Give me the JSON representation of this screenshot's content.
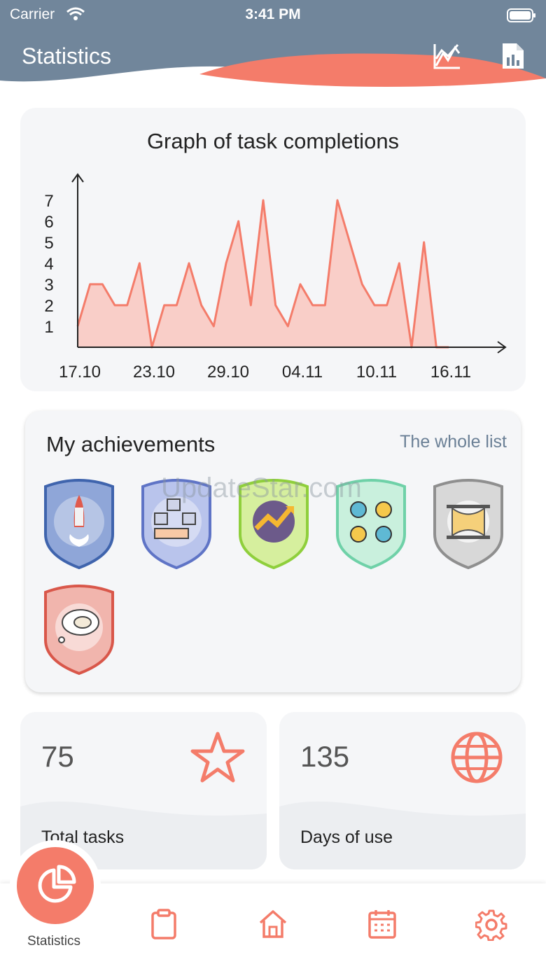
{
  "status_bar": {
    "carrier": "Carrier",
    "time": "3:41 PM"
  },
  "header": {
    "title": "Statistics",
    "icons": [
      "chart-line-icon",
      "report-document-icon"
    ]
  },
  "graph_card": {
    "title": "Graph of task completions",
    "chart_data": {
      "type": "area",
      "x_tick_labels": [
        "17.10",
        "23.10",
        "29.10",
        "04.11",
        "10.11",
        "16.11"
      ],
      "y_tick_labels": [
        "1",
        "2",
        "3",
        "4",
        "5",
        "6",
        "7"
      ],
      "ylim": [
        0,
        7
      ],
      "values": [
        1,
        3,
        3,
        2,
        2,
        4,
        0,
        2,
        2,
        4,
        2,
        1,
        4,
        6,
        2,
        7,
        2,
        1,
        3,
        2,
        2,
        7,
        5,
        3,
        2,
        2,
        4,
        0,
        5,
        0,
        0
      ],
      "colors": {
        "line": "#f47c6a",
        "fill": "#f9c7bf"
      }
    }
  },
  "achievements": {
    "title": "My achievements",
    "link": "The whole list",
    "badges": [
      {
        "name": "rocket-badge",
        "color": "#3f64ad",
        "fill": "#8fa6d8"
      },
      {
        "name": "rating-hand-badge",
        "color": "#5f74c6",
        "fill": "#b9c4ec"
      },
      {
        "name": "growth-arrow-badge",
        "color": "#8fcf3c",
        "fill": "#d6ef9e"
      },
      {
        "name": "teamwork-cycle-badge",
        "color": "#6fd1a8",
        "fill": "#c9f0dd"
      },
      {
        "name": "hourglass-badge",
        "color": "#8f8f8f",
        "fill": "#d8d8d8"
      },
      {
        "name": "dream-sheep-badge",
        "color": "#d9574a",
        "fill": "#f1b5ad"
      }
    ],
    "watermark": "UpdateStar.com"
  },
  "stats": [
    {
      "value": "75",
      "label": "Total tasks",
      "icon": "star-icon"
    },
    {
      "value": "135",
      "label": "Days of use",
      "icon": "globe-icon"
    }
  ],
  "tabbar": {
    "active_label": "Statistics",
    "tabs": [
      "pie-chart-icon",
      "clipboard-icon",
      "home-icon",
      "calendar-icon",
      "settings-icon"
    ]
  },
  "colors": {
    "accent": "#f47c6a",
    "header": "#71869b",
    "card": "#f5f6f8",
    "link": "#6b8096"
  }
}
